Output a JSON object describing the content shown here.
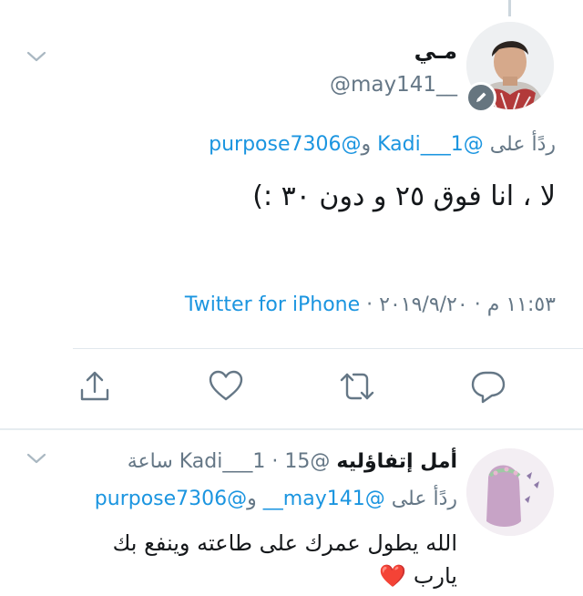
{
  "tweet": {
    "name": "مـي",
    "handle": "@may141__",
    "reply_prefix": "ردًأ على",
    "reply_mention_1": "@Kadi___1",
    "reply_conjunction": "و",
    "reply_mention_2": "@purpose7306",
    "text": "لا ، انا فوق ٢٥ و دون ٣٠ :)",
    "time": "١١:٥٣ م",
    "date": "٢٠١٩/٩/٢٠",
    "separator": "·",
    "source": "Twitter for iPhone"
  },
  "actions": [
    "share-icon",
    "like-icon",
    "retweet-icon",
    "reply-icon"
  ],
  "reply": {
    "name": "أمل إتفاؤليه",
    "handle": "@Kadi___1",
    "separator": "·",
    "time": "15 ساعة",
    "reply_prefix": "ردًأ على",
    "reply_mention_1": "@may141__",
    "reply_conjunction": "و",
    "reply_mention_2": "@purpose7306",
    "text": "الله يطول عمرك على طاعته وينفع بك يارب",
    "emoji": "❤️"
  },
  "colors": {
    "link": "#1b95e0",
    "muted": "#657786",
    "icon": "#657786",
    "heart": "#e0245e"
  }
}
